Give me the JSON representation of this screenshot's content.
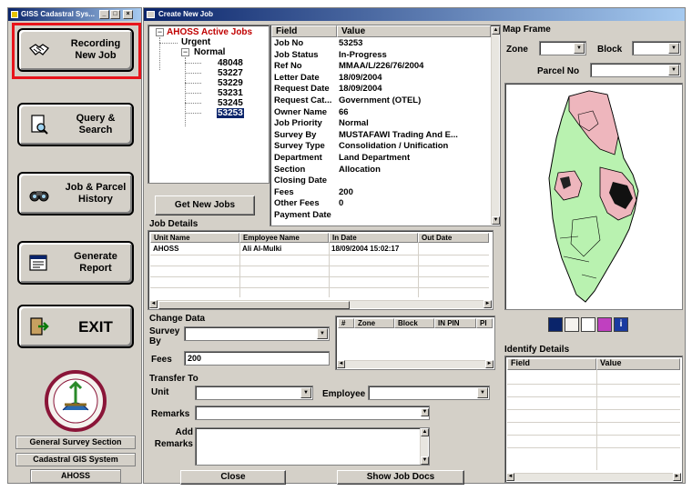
{
  "launcher": {
    "title": "GISS Cadastral Sys...",
    "buttons": [
      {
        "label": "Recording\nNew Job",
        "icon": "handshake-icon"
      },
      {
        "label": "Query &\nSearch",
        "icon": "document-search-icon"
      },
      {
        "label": "Job & Parcel\nHistory",
        "icon": "binoculars-icon"
      },
      {
        "label": "Generate\nReport",
        "icon": "report-icon"
      },
      {
        "label": "EXIT",
        "icon": "exit-icon"
      }
    ],
    "info_lines": [
      "General Survey Section",
      "Cadastral GIS System",
      "AHOSS"
    ],
    "title_buttons": [
      "_",
      "□",
      "×"
    ]
  },
  "main": {
    "title": "Create New Job",
    "tree": {
      "root": "AHOSS Active Jobs",
      "nodes": [
        {
          "label": "Urgent",
          "children": []
        },
        {
          "label": "Normal",
          "children": [
            "48048",
            "53227",
            "53229",
            "53231",
            "53245",
            "53253"
          ]
        }
      ],
      "selected": "53253"
    },
    "get_new_jobs": "Get New Jobs",
    "properties": {
      "headers": [
        "Field",
        "Value"
      ],
      "rows": [
        {
          "field": "Job No",
          "value": "53253"
        },
        {
          "field": "Job Status",
          "value": "In-Progress"
        },
        {
          "field": "Ref No",
          "value": "MMAA/L/226/76/2004"
        },
        {
          "field": "Letter Date",
          "value": "18/09/2004"
        },
        {
          "field": "Request Date",
          "value": "18/09/2004"
        },
        {
          "field": "Request Cat...",
          "value": "Government (OTEL)"
        },
        {
          "field": "Owner Name",
          "value": "66"
        },
        {
          "field": "Job Priority",
          "value": "Normal"
        },
        {
          "field": "Survey By",
          "value": "MUSTAFAWI Trading And E..."
        },
        {
          "field": "Survey Type",
          "value": "Consolidation / Unification"
        },
        {
          "field": "Department",
          "value": "Land Department"
        },
        {
          "field": "Section",
          "value": "Allocation"
        },
        {
          "field": "Closing Date",
          "value": ""
        },
        {
          "field": "Fees",
          "value": "200"
        },
        {
          "field": "Other Fees",
          "value": "0"
        },
        {
          "field": "Payment Date",
          "value": ""
        }
      ]
    },
    "job_details": {
      "title": "Job Details",
      "headers": [
        "Unit Name",
        "Employee Name",
        "In Date",
        "Out Date"
      ],
      "rows": [
        [
          "AHOSS",
          "Ali Al-Mulki",
          "18/09/2004 15:02:17",
          ""
        ]
      ]
    },
    "change_data": {
      "title": "Change Data",
      "survey_by_label": "Survey\nBy",
      "survey_by_value": "",
      "fees_label": "Fees",
      "fees_value": "200",
      "parcel_headers": [
        "#",
        "Zone",
        "Block",
        "IN PIN",
        "PI"
      ]
    },
    "transfer": {
      "title": "Transfer To",
      "unit_label": "Unit",
      "employee_label": "Employee",
      "remarks_label": "Remarks",
      "add_remarks_label": "Add\nRemarks"
    },
    "close_button": "Close",
    "show_job_docs_button": "Show Job Docs",
    "map_frame": {
      "title": "Map Frame",
      "zone_label": "Zone",
      "block_label": "Block",
      "parcel_label": "Parcel No",
      "tool_icons": [
        "globe-icon",
        "pan-hand-icon",
        "zoom-box-icon",
        "select-icon",
        "info-icon"
      ],
      "colors": {
        "land": "#b9f2b0",
        "developed": "#eeb6bd",
        "border": "#000000"
      }
    },
    "identify": {
      "title": "Identify Details",
      "headers": [
        "Field",
        "Value"
      ]
    }
  }
}
